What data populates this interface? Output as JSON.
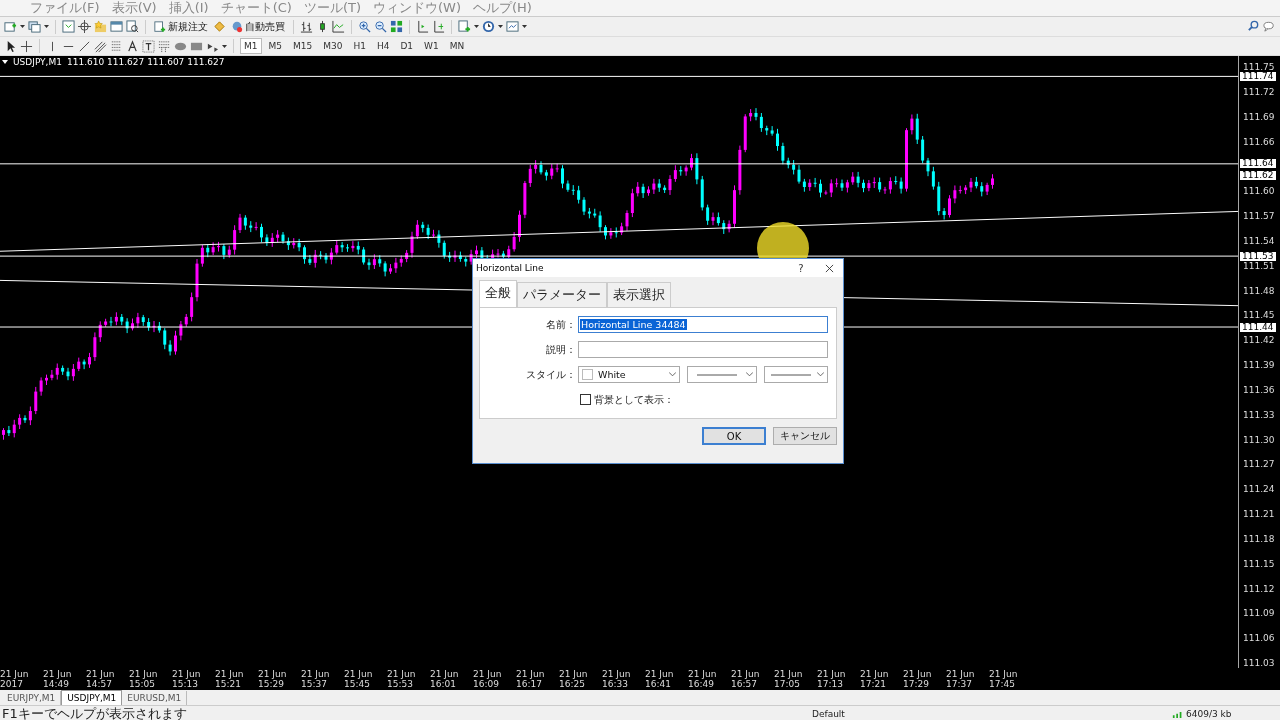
{
  "menu": [
    "ファイル(F)",
    "表示(V)",
    "挿入(I)",
    "チャート(C)",
    "ツール(T)",
    "ウィンドウ(W)",
    "ヘルプ(H)"
  ],
  "toolbar": {
    "buttons": [
      {
        "label": "新規注文"
      },
      {
        "label": "自動売買"
      }
    ],
    "timeframes": [
      {
        "label": "M1",
        "selected": true
      },
      {
        "label": "M5",
        "selected": false
      },
      {
        "label": "M15",
        "selected": false
      },
      {
        "label": "M30",
        "selected": false
      },
      {
        "label": "H1",
        "selected": false
      },
      {
        "label": "H4",
        "selected": false
      },
      {
        "label": "D1",
        "selected": false
      },
      {
        "label": "W1",
        "selected": false
      },
      {
        "label": "MN",
        "selected": false
      }
    ]
  },
  "chart": {
    "symbol": "USDJPY,M1",
    "quotes": "111.610 111.627 111.607 111.627",
    "price_labels": [
      "111.75",
      "111.72",
      "111.69",
      "111.66",
      "111.60",
      "111.57",
      "111.54",
      "111.51",
      "111.48",
      "111.45",
      "111.42",
      "111.39",
      "111.36",
      "111.33",
      "111.30",
      "111.27",
      "111.24",
      "111.21",
      "111.18",
      "111.15",
      "111.12",
      "111.09",
      "111.06",
      "111.03"
    ],
    "price_tags": [
      "111.74",
      "111.64",
      "111.62",
      "111.53",
      "111.44"
    ],
    "time_labels": [
      "21 Jun 2017",
      "21 Jun 14:49",
      "21 Jun 14:57",
      "21 Jun 15:05",
      "21 Jun 15:13",
      "21 Jun 15:21",
      "21 Jun 15:29",
      "21 Jun 15:37",
      "21 Jun 15:45",
      "21 Jun 15:53",
      "21 Jun 16:01",
      "21 Jun 16:09",
      "21 Jun 16:17",
      "21 Jun 16:25",
      "21 Jun 16:33",
      "21 Jun 16:41",
      "21 Jun 16:49",
      "21 Jun 16:57",
      "21 Jun 17:05",
      "21 Jun 17:13",
      "21 Jun 17:21",
      "21 Jun 17:29",
      "21 Jun 17:37",
      "21 Jun 17:45"
    ]
  },
  "dialog": {
    "title": "Horizontal Line",
    "help": "?",
    "tabs": [
      {
        "label": "全般",
        "selected": true
      },
      {
        "label": "パラメーター",
        "selected": false
      },
      {
        "label": "表示選択",
        "selected": false
      }
    ],
    "name": {
      "label": "名前：",
      "value": "Horizontal Line 34484"
    },
    "description": {
      "label": "説明："
    },
    "style": {
      "label": "スタイル：",
      "color_name": "White"
    },
    "background": {
      "label": "背景として表示：",
      "checked": false
    },
    "ok": "OK",
    "cancel": "キャンセル"
  },
  "chart_tabs": [
    {
      "label": "EURJPY,M1",
      "selected": false
    },
    {
      "label": "USDJPY,M1",
      "selected": true
    },
    {
      "label": "EURUSD,M1",
      "selected": false
    }
  ],
  "status_bar": {
    "hint": "F1キーでヘルプが表示されます",
    "profile": "Default",
    "traffic": "6409/3 kb"
  }
}
